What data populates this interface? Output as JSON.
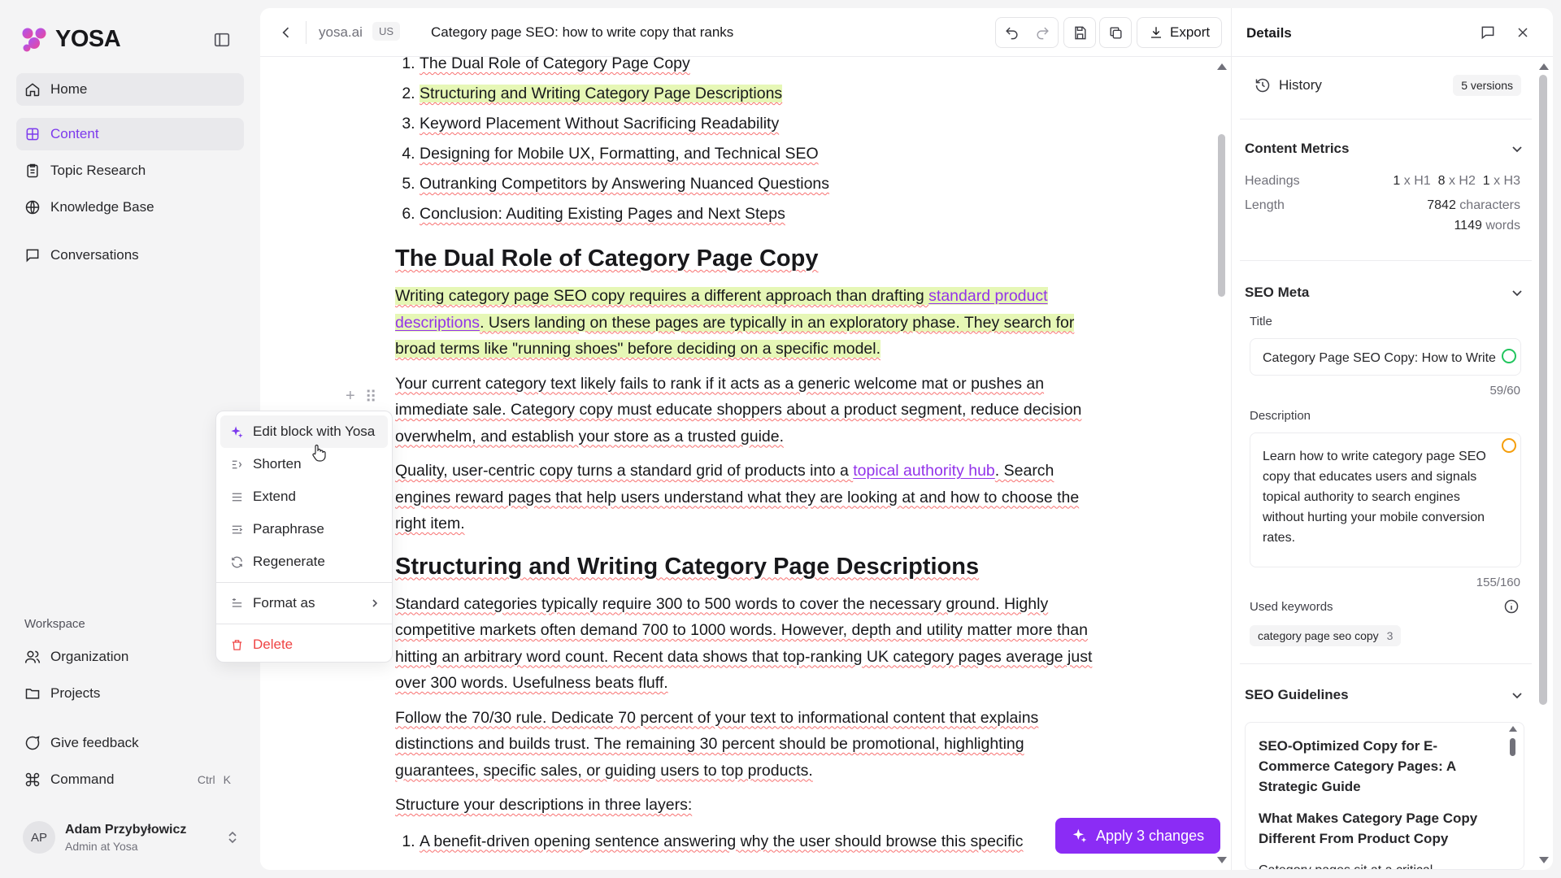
{
  "app": {
    "name": "YOSA",
    "brand_color": "#7c3aed"
  },
  "sidebar": {
    "nav": [
      {
        "label": "Home",
        "icon": "home-icon"
      },
      {
        "label": "Content",
        "icon": "content-icon",
        "active": true
      },
      {
        "label": "Topic Research",
        "icon": "clipboard-icon"
      },
      {
        "label": "Knowledge Base",
        "icon": "globe-icon"
      },
      {
        "label": "Conversations",
        "icon": "chat-icon"
      }
    ],
    "workspace_label": "Workspace",
    "workspace_items": [
      {
        "label": "Organization",
        "icon": "users-icon"
      },
      {
        "label": "Projects",
        "icon": "folder-icon"
      }
    ],
    "bottom_items": [
      {
        "label": "Give feedback",
        "icon": "feedback-icon"
      },
      {
        "label": "Command",
        "icon": "command-icon",
        "shortcut": [
          "Ctrl",
          "K"
        ]
      }
    ],
    "user": {
      "initials": "AP",
      "name": "Adam Przybyłowicz",
      "role": "Admin at Yosa"
    }
  },
  "editor": {
    "site": "yosa.ai",
    "locale": "US",
    "title": "Category page SEO: how to write copy that ranks",
    "export_label": "Export",
    "apply_label": "Apply 3 changes",
    "toc": [
      "The Dual Role of Category Page Copy",
      "Structuring and Writing Category Page Descriptions",
      "Keyword Placement Without Sacrificing Readability",
      "Designing for Mobile UX, Formatting, and Technical SEO",
      "Outranking Competitors by Answering Nuanced Questions",
      "Conclusion: Auditing Existing Pages and Next Steps"
    ],
    "h2_1": "The Dual Role of Category Page Copy",
    "p1": {
      "a": "Writing category page SEO copy requires a different approach than drafting ",
      "link": "standard product descriptions",
      "b": ". Users landing on these pages are typically in an exploratory phase. They search for broad terms like \"running shoes\" before deciding on a specific model."
    },
    "p2": "Your current category text likely fails to rank if it acts as a generic welcome mat or pushes an immediate sale. Category copy must educate shoppers about a product segment, reduce decision overwhelm, and establish your store as a trusted guide.",
    "p3": {
      "a": "Quality, user-centric copy turns a standard grid of products into a ",
      "link": "topical authority hub",
      "b": ". Search engines reward pages that help users understand what they are looking at and how to choose the right item."
    },
    "h2_2": "Structuring and Writing Category Page Descriptions",
    "p4": "Standard categories typically require 300 to 500 words to cover the necessary ground. Highly competitive markets often demand 700 to 1000 words. However, depth and utility matter more than hitting an arbitrary word count. Recent data shows that top-ranking UK category pages average just over 300 words. Usefulness beats fluff.",
    "p5": "Follow the 70/30 rule. Dedicate 70 percent of your text to informational content that explains distinctions and builds trust. The remaining 30 percent should be promotional, highlighting guarantees, specific sales, or guiding users to top products.",
    "p6": "Structure your descriptions in three layers:",
    "list2_first": "A benefit-driven opening sentence answering why the user should browse this specific"
  },
  "context_menu": {
    "items": [
      {
        "label": "Edit block with Yosa",
        "icon": "sparkle-icon"
      },
      {
        "label": "Shorten",
        "icon": "shorten-icon"
      },
      {
        "label": "Extend",
        "icon": "extend-icon"
      },
      {
        "label": "Paraphrase",
        "icon": "paraphrase-icon"
      },
      {
        "label": "Regenerate",
        "icon": "refresh-icon"
      }
    ],
    "format_label": "Format as",
    "delete_label": "Delete"
  },
  "details": {
    "title": "Details",
    "history": {
      "label": "History",
      "badge": "5 versions"
    },
    "metrics": {
      "title": "Content Metrics",
      "headings_label": "Headings",
      "h1_count": "1",
      "h2_count": "8",
      "h3_count": "1",
      "length_label": "Length",
      "characters": "7842",
      "characters_unit": "characters",
      "words": "1149",
      "words_unit": "words"
    },
    "seo_meta": {
      "title": "SEO Meta",
      "title_label": "Title",
      "title_value": "Category Page SEO Copy: How to Write",
      "title_count": "59/60",
      "title_status_color": "#22c55e",
      "description_label": "Description",
      "description_value": "Learn how to write category page SEO copy that educates users and signals topical authority to search engines without hurting your mobile conversion rates.",
      "description_count": "155/160",
      "description_status_color": "#f59e0b",
      "keywords_label": "Used keywords",
      "keyword": "category page seo copy",
      "keyword_count": "3"
    },
    "guidelines": {
      "title": "SEO Guidelines",
      "h1": "SEO-Optimized Copy for E-Commerce Category Pages: A Strategic Guide",
      "h2": "What Makes Category Page Copy Different From Product Copy",
      "p": "Category pages sit at a critical"
    }
  }
}
